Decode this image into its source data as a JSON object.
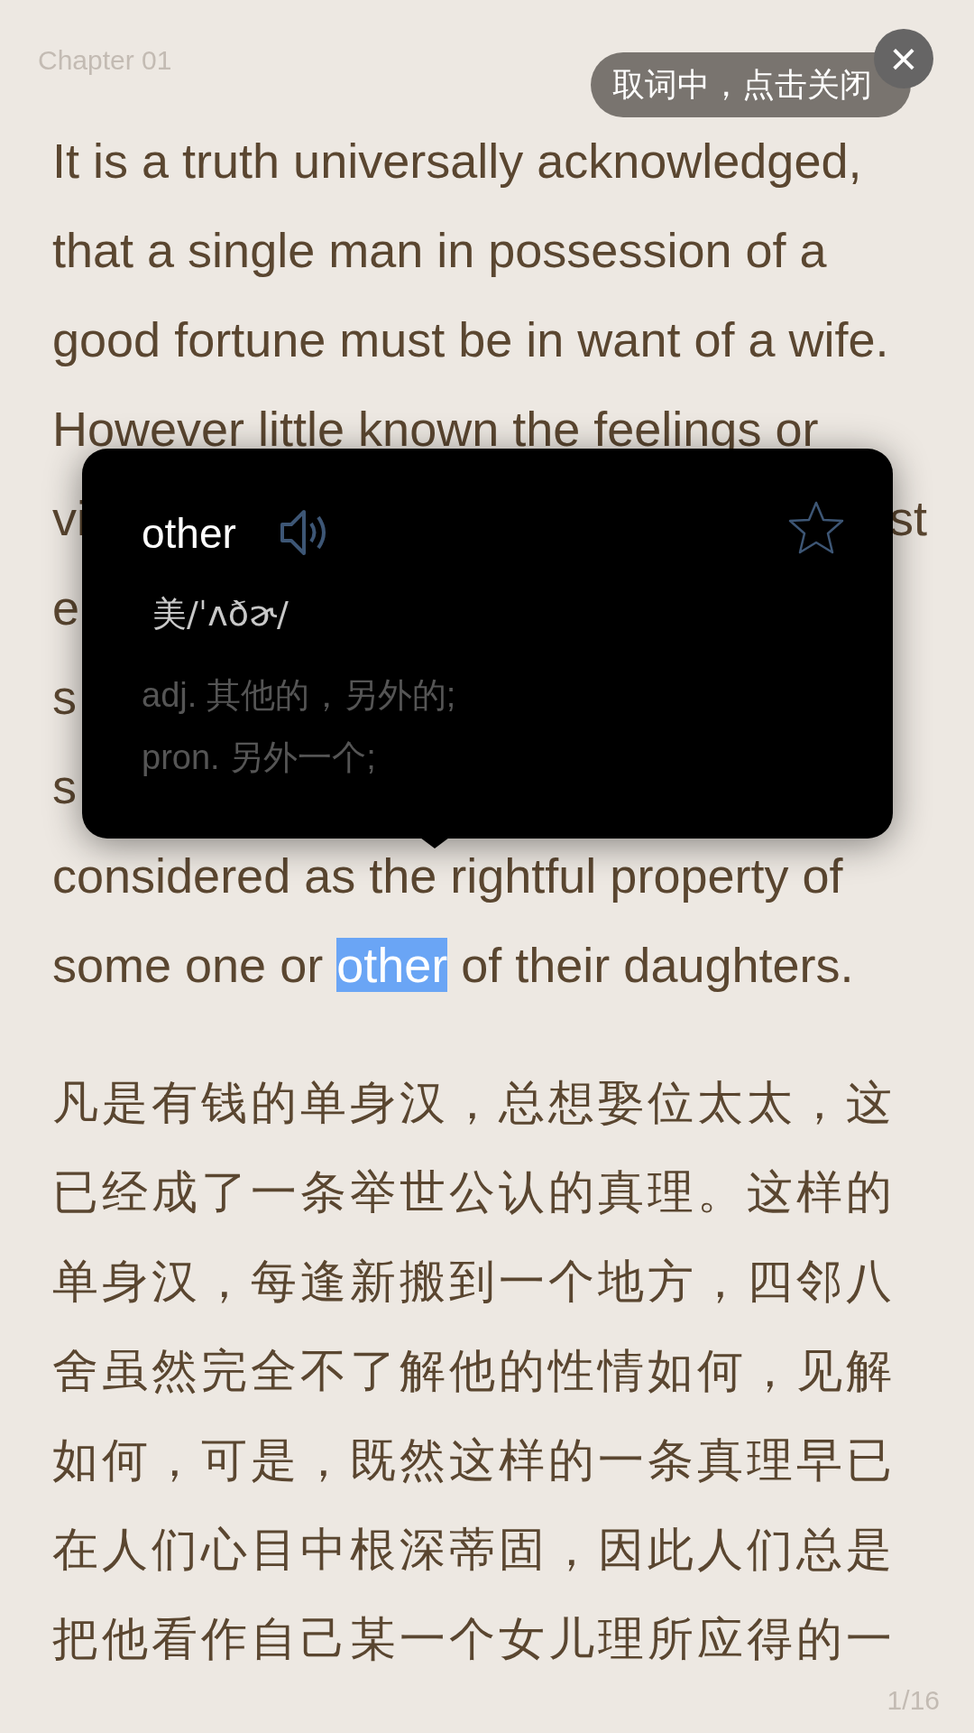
{
  "header": {
    "chapter": "Chapter 01"
  },
  "toast": {
    "text": "取词中，点击关闭",
    "close_symbol": "×"
  },
  "english_lines": [
    {
      "kind": "full",
      "parts": [
        {
          "text": "It is a truth universally acknowledged,",
          "selected": false
        }
      ]
    },
    {
      "kind": "full",
      "parts": [
        {
          "text": "that a single man in possession of a",
          "selected": false
        }
      ]
    },
    {
      "kind": "full",
      "parts": [
        {
          "text": "good fortune must be in want of a wife.",
          "selected": false
        }
      ]
    },
    {
      "kind": "full",
      "parts": [
        {
          "text": "However little known the feelings or",
          "selected": false
        }
      ]
    },
    {
      "kind": "covered",
      "parts": [
        {
          "text": "vi",
          "selected": false
        },
        {
          "text": "st",
          "selected": false
        }
      ]
    },
    {
      "kind": "covered",
      "parts": [
        {
          "text": "e",
          "selected": false
        }
      ]
    },
    {
      "kind": "covered",
      "parts": [
        {
          "text": "s",
          "selected": false
        }
      ]
    },
    {
      "kind": "covered",
      "parts": [
        {
          "text": "s",
          "selected": false
        }
      ]
    },
    {
      "kind": "full",
      "parts": [
        {
          "text": "considered as the rightful property of",
          "selected": false
        }
      ]
    },
    {
      "kind": "full",
      "parts": [
        {
          "text": "some one or ",
          "selected": false
        },
        {
          "text": "other",
          "selected": true
        },
        {
          "text": " of their daughters.",
          "selected": false
        }
      ]
    }
  ],
  "chinese_lines": [
    "凡是有钱的单身汉，总想娶位太太，这",
    "已经成了一条举世公认的真理。这样的",
    "单身汉，每逢新搬到一个地方，四邻八",
    "舍虽然完全不了解他的性情如何，见解",
    "如何，可是，既然这样的一条真理早已",
    "在人们心目中根深蒂固，因此人们总是",
    "把他看作自己某一个女儿理所应得的一"
  ],
  "dictionary_popup": {
    "word": "other",
    "favorited": false,
    "phonetic": "美/ˈʌðɚ/",
    "definitions": [
      "adj. 其他的，另外的;",
      "pron. 另外一个;"
    ]
  },
  "footer": {
    "page": "1/16"
  }
}
